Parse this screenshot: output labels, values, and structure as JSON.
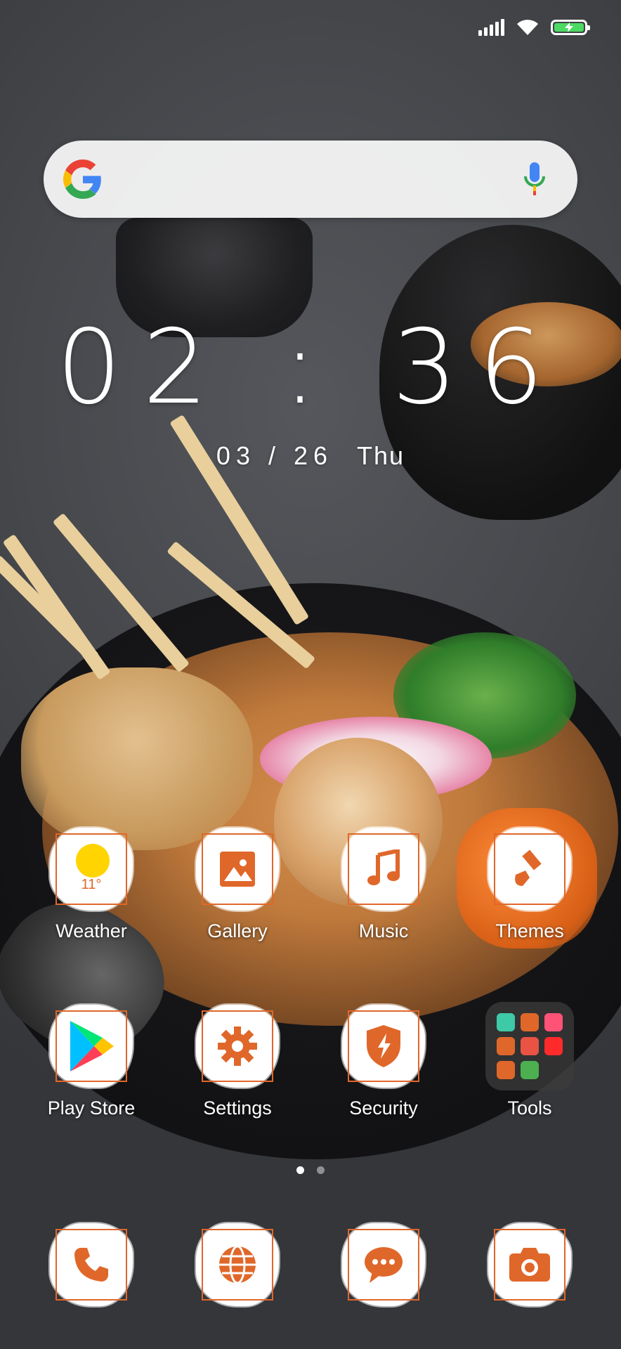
{
  "status_bar": {
    "signal": "signal-icon",
    "wifi": "wifi-icon",
    "battery": "battery-charging-icon"
  },
  "search": {
    "logo": "google-logo-icon",
    "mic": "mic-icon"
  },
  "clock": {
    "time": "02 : 36",
    "date": "03 / 26",
    "weekday": "Thu"
  },
  "weather_widget": {
    "temp": "11°"
  },
  "apps": [
    {
      "label": "Weather",
      "icon": "weather-icon"
    },
    {
      "label": "Gallery",
      "icon": "gallery-icon"
    },
    {
      "label": "Music",
      "icon": "music-icon"
    },
    {
      "label": "Themes",
      "icon": "themes-icon"
    },
    {
      "label": "Play Store",
      "icon": "play-store-icon"
    },
    {
      "label": "Settings",
      "icon": "settings-icon"
    },
    {
      "label": "Security",
      "icon": "security-icon"
    },
    {
      "label": "Tools",
      "icon": "folder-icon"
    }
  ],
  "page_indicator": {
    "pages": 2,
    "current": 1
  },
  "dock": [
    {
      "icon": "phone-icon"
    },
    {
      "icon": "browser-icon"
    },
    {
      "icon": "messages-icon"
    },
    {
      "icon": "camera-icon"
    }
  ],
  "colors": {
    "accent": "#e0672a",
    "battery": "#4cd964"
  }
}
